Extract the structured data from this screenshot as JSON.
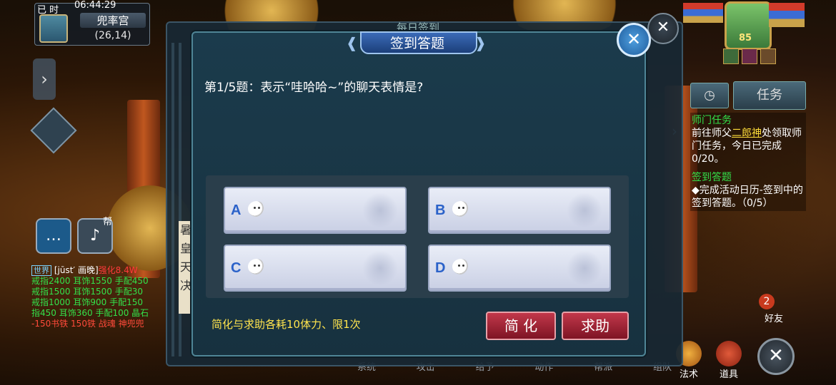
{
  "status": {
    "time_tag": "已 时",
    "clock": "06:44:29",
    "map_name": "兜率宫",
    "coords": "(26,14)"
  },
  "left_controls": {
    "chat_icon": "speech-bubble-icon",
    "voice_icon": "microphone-icon",
    "voice_tag": "帮"
  },
  "chat_log": [
    {
      "channel": "世界",
      "text": "[jūst′ 画晚]",
      "highlight": "强化8.4W",
      "color": "#ffffff"
    },
    {
      "text": "戒指2400 耳饰1550 手配450",
      "color": "#33e04a"
    },
    {
      "text": "戒指1500 耳饰1500 手配30",
      "color": "#33e04a"
    },
    {
      "text": "戒指1000 耳饰900 手配150",
      "color": "#33e04a"
    },
    {
      "text": "指450 耳饰360 手配100 晶石",
      "color": "#33e04a"
    },
    {
      "text": "-150书铁 150铁 战魂 神兜兜",
      "color": "#ff4a3a"
    }
  ],
  "player": {
    "level": "85"
  },
  "task_panel": {
    "tab_label": "任务",
    "tasks": [
      {
        "title": "师门任务",
        "line1": "前往师父",
        "npc": "二郎神",
        "line2": "处领取师门任务，今日已完成0/20。"
      },
      {
        "title": "签到答题",
        "line1": "◆完成活动日历-签到中的签到答题。（0/5）"
      }
    ]
  },
  "friend": {
    "badge": "2",
    "label": "好友"
  },
  "skills": [
    {
      "label": "法术"
    },
    {
      "label": "道具"
    }
  ],
  "bottom_menu": [
    "系统",
    "攻击",
    "给予",
    "动作",
    "帮派",
    "组队"
  ],
  "back_panel": {
    "title": "每日签到",
    "side_chars": [
      "暑",
      "皇",
      "天",
      "决"
    ]
  },
  "dialog": {
    "title": "签到答题",
    "question": "第1/5题：表示“哇哈哈~”的聊天表情是?",
    "options": [
      {
        "letter": "A",
        "emoji": "bunny-emoji-a"
      },
      {
        "letter": "B",
        "emoji": "bunny-emoji-b"
      },
      {
        "letter": "C",
        "emoji": "bunny-emoji-c"
      },
      {
        "letter": "D",
        "emoji": "bunny-emoji-d"
      }
    ],
    "note": "简化与求助各耗10体力、限1次",
    "simplify_label": "简 化",
    "help_label": "求助"
  }
}
